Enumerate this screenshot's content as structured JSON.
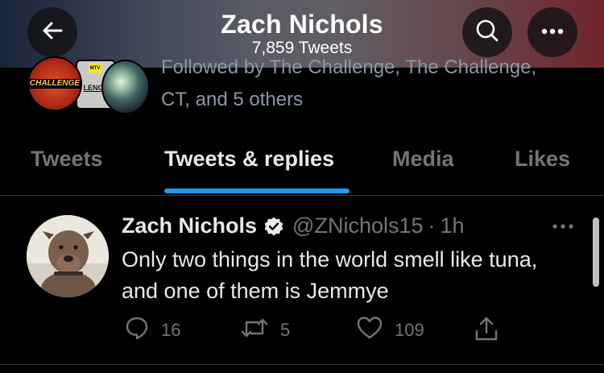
{
  "header": {
    "title": "Zach Nichols",
    "subtitle": "7,859 Tweets",
    "gradient_colors": [
      "#1f2b44",
      "#77737c",
      "#8a2e35"
    ]
  },
  "buttons": {
    "back_icon": "arrow-left-icon",
    "search_icon": "search-icon",
    "more_icon": "more-horizontal-icon"
  },
  "followed_by": {
    "line1": "Followed by The Challenge, The Challenge,",
    "line2": "CT, and 5 others",
    "avatar1_text": "CHALLENGE",
    "avatar2_logo": "MTV",
    "avatar2_text": "LENGE"
  },
  "tabs": [
    {
      "label": "Tweets",
      "active": false
    },
    {
      "label": "Tweets & replies",
      "active": true
    },
    {
      "label": "Media",
      "active": false
    },
    {
      "label": "Likes",
      "active": false
    }
  ],
  "tweet": {
    "author": "Zach Nichols",
    "handle": "@ZNichols15",
    "separator": "·",
    "time": "1h",
    "text": "Only two things in the world smell like tuna, and one of them is Jemmye",
    "replies": "16",
    "retweets": "5",
    "likes": "109"
  },
  "colors": {
    "accent": "#1d9bf0",
    "background": "#000000",
    "muted_text": "#71767b"
  }
}
